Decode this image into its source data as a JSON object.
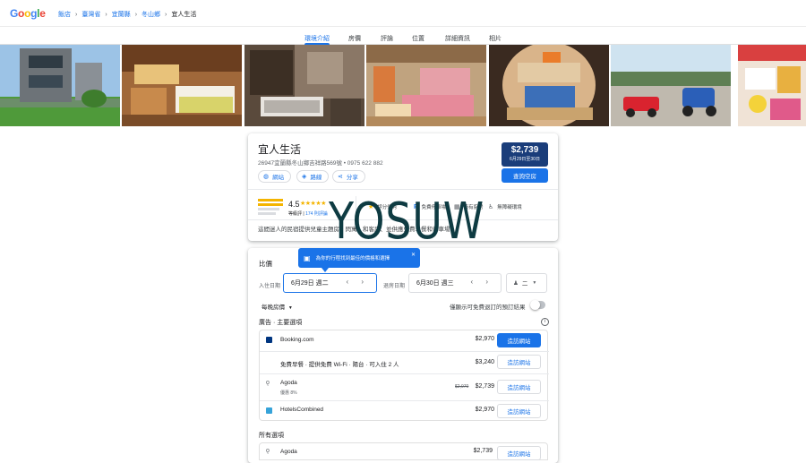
{
  "header": {
    "logo": "Google",
    "logo_colors": [
      "#4285F4",
      "#EA4335",
      "#FBBC05",
      "#4285F4",
      "#34A853",
      "#EA4335"
    ],
    "breadcrumbs": [
      "飯店",
      "臺灣省",
      "宜蘭縣",
      "冬山鄉",
      "宜人生活"
    ]
  },
  "tabs": [
    "環境介紹",
    "房價",
    "評論",
    "位置",
    "詳細資訊",
    "相片"
  ],
  "active_tab": "環境介紹",
  "hotel": {
    "name": "宜人生活",
    "address": "26947宜蘭縣冬山鄉吉祥路569號 • 0975 622 882",
    "chips": [
      {
        "icon": "globe-icon",
        "label": "網站"
      },
      {
        "icon": "directions-icon",
        "label": "路線"
      },
      {
        "icon": "share-icon",
        "label": "分享"
      }
    ],
    "price": "$2,739",
    "price_dates": "6月29日至30日",
    "check_availability": "查詢空房",
    "rating": "4.5",
    "stars": "★★★★★",
    "rating_type": "等級評",
    "review_count": "174 則評論",
    "amenities": [
      {
        "icon": "star-icon",
        "label": "評分優秀"
      },
      {
        "icon": "parking-icon",
        "label": "免費停車場"
      },
      {
        "icon": "kitchen-icon",
        "label": "設有廚房"
      },
      {
        "icon": "wheelchair-icon",
        "label": "無障礙環境"
      },
      {
        "icon": "family-icon",
        "label": "閱覽/家庭"
      }
    ],
    "description": "這間迷人的民宿提供兒童主題房、閃寓、和客房、並供應免費早餐和停車場"
  },
  "watermark": "YOSUW",
  "compare": {
    "title": "比價",
    "tooltip": "為你的行程找到最佳的價格和選擇",
    "checkin_label": "入住日期",
    "checkin_value": "6月29日 週二",
    "checkout_label": "退房日期",
    "checkout_value": "6月30日 週三",
    "guests_value": "二",
    "per_night": "每晚房價",
    "free_cancel_label": "僅顯示可免費退訂的預訂結果",
    "ads_title": "廣告 · 主要選項",
    "all_title": "所有選項",
    "ad_rows": [
      {
        "name": "Booking.com",
        "price": "$2,970",
        "button": "造訪網站",
        "button_primary": true,
        "logo_color": "#003580"
      },
      {
        "name": "免費早餐 · 提供免費 Wi-Fi · 陽台 · 可入住 2 人",
        "price": "$3,240",
        "button": "造訪網站",
        "button_primary": false
      },
      {
        "name": "Agoda",
        "sub": "優惠 8%",
        "strike": "$2,970",
        "price": "$2,739",
        "button": "造訪網站",
        "button_primary": false
      },
      {
        "name": "HotelsCombined",
        "price": "$2,970",
        "button": "造訪網站",
        "button_primary": false,
        "logo_color": "#36a3d9"
      }
    ],
    "all_rows": [
      {
        "name": "Agoda",
        "price": "$2,739",
        "button": "造訪網站"
      }
    ]
  }
}
